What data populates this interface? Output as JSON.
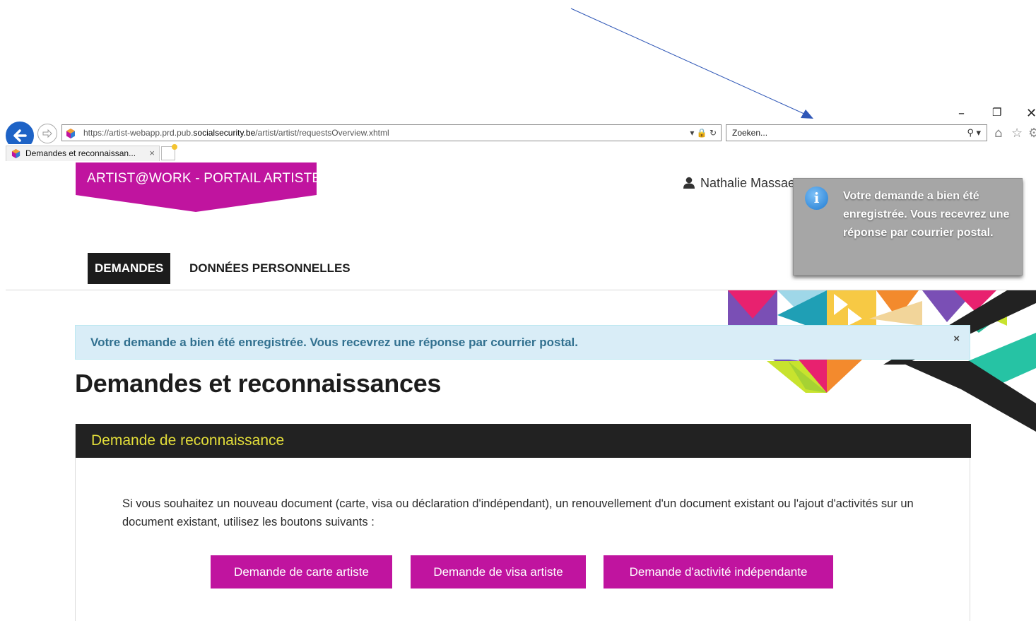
{
  "browser": {
    "url_prefix": "https://artist-webapp.prd.pub.",
    "url_domain": "socialsecurity.be",
    "url_path": "/artist/artist/requestsOverview.xhtml",
    "search_placeholder": "Zoeken...",
    "tab_title": "Demandes et reconnaissan...",
    "tab_close": "×",
    "url_tools": "▾ 🔒 ↻",
    "search_tools": "⚲ ▾",
    "window_controls": {
      "minimize": "–",
      "restore": "❐",
      "close": "✕"
    },
    "toolbar_icons": {
      "home": "⌂",
      "favorites": "☆",
      "settings": "⚙"
    }
  },
  "header": {
    "portal_title": "ARTIST@WORK - PORTAIL ARTISTE",
    "user_name": "Nathalie Massae"
  },
  "nav": {
    "items": [
      {
        "label": "DEMANDES",
        "active": true
      },
      {
        "label": "DONNÉES PERSONNELLES",
        "active": false
      }
    ]
  },
  "alert": {
    "message": "Votre demande a bien été enregistrée. Vous recevrez une réponse par courrier postal.",
    "close": "×"
  },
  "page": {
    "title": "Demandes et reconnaissances"
  },
  "panel": {
    "title": "Demande de reconnaissance",
    "text": "Si vous souhaitez un nouveau document (carte, visa ou déclaration d'indépendant), un renouvellement d'un document existant ou l'ajout d'activités sur un document existant, utilisez les boutons suivants :",
    "buttons": [
      "Demande de carte artiste",
      "Demande de visa artiste",
      "Demande d'activité indépendante"
    ]
  },
  "toast": {
    "icon_glyph": "i",
    "message": "Votre demande a bien été enregistrée. Vous recevrez une réponse par courrier postal."
  },
  "colors": {
    "brand_magenta": "#c0149f",
    "panel_header": "#222222",
    "panel_title": "#e3de3a",
    "alert_bg": "#d9edf7",
    "alert_text": "#31708f",
    "toast_bg": "#a6a6a6",
    "browser_back": "#1e63c6",
    "annotation_arrow": "#2f57b7"
  }
}
